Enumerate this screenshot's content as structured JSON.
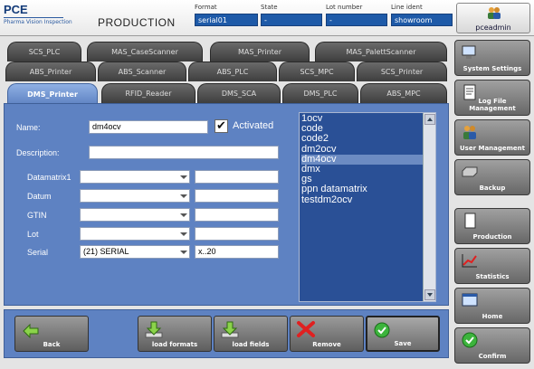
{
  "header": {
    "logo_main": "PCE",
    "logo_sub": "Pharma Vision Inspection",
    "page_title": "PRODUCTION",
    "format_label": "Format",
    "format_value": "serial01",
    "state_label": "State",
    "state_value": "-",
    "lot_label": "Lot number",
    "lot_value": "-",
    "line_label": "Line ident",
    "line_value": "showroom",
    "user_name": "pceadmin"
  },
  "tabs": {
    "row1": [
      "SCS_PLC",
      "MAS_CaseScanner",
      "MAS_Printer",
      "MAS_PalettScanner"
    ],
    "row2": [
      "ABS_Printer",
      "ABS_Scanner",
      "ABS_PLC",
      "SCS_MPC",
      "SCS_Printer"
    ],
    "row3": [
      "DMS_Printer",
      "RFID_Reader",
      "DMS_SCA",
      "DMS_PLC",
      "ABS_MPC"
    ]
  },
  "form": {
    "name_label": "Name:",
    "name_value": "dm4ocv",
    "activated_label": "Activated",
    "activated_checked": true,
    "description_label": "Description:",
    "description_value": "",
    "fields": [
      {
        "label": "Datamatrix1",
        "select": "",
        "value": ""
      },
      {
        "label": "Datum",
        "select": "",
        "value": ""
      },
      {
        "label": "GTIN",
        "select": "",
        "value": ""
      },
      {
        "label": "Lot",
        "select": "",
        "value": ""
      },
      {
        "label": "Serial",
        "select": "(21) SERIAL",
        "value": "x..20"
      }
    ]
  },
  "list": {
    "items": [
      "1ocv",
      "code",
      "code2",
      "dm2ocv",
      "dm4ocv",
      "dmx",
      "gs",
      "ppn datamatrix",
      "testdm2ocv"
    ],
    "selected": "dm4ocv"
  },
  "buttons": {
    "back": "Back",
    "load_formats": "load formats",
    "load_fields": "load fields",
    "remove": "Remove",
    "save": "Save"
  },
  "sidebar": [
    "System Settings",
    "Log File Management",
    "User Management",
    "Backup",
    "Production",
    "Statistics",
    "Home",
    "Confirm"
  ],
  "colors": {
    "accent": "#5e82c2",
    "field_blue": "#1e5aa8",
    "list_bg": "#2a5096"
  }
}
